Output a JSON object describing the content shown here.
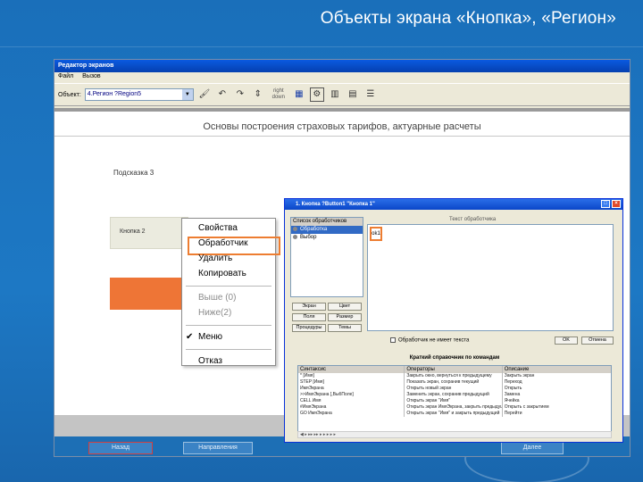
{
  "slide": {
    "title": "Объекты экрана «Кнопка», «Регион»"
  },
  "editor": {
    "title": "Редактор экранов",
    "menu": [
      "Файл",
      "Вызов"
    ],
    "object_label": "Объект:",
    "object_value": "4.Регион ?Region5",
    "toolbar_small_label_1": "right",
    "toolbar_small_label_2": "down",
    "canvas_header": "Основы построения страховых тарифов, актуарные расчеты",
    "hint_label": "Подсказка 3",
    "button2_label": "Кнопка 2",
    "nav_left": "Назад",
    "nav_mid": "Направления",
    "nav_right": "Далее"
  },
  "context_menu": {
    "items": [
      {
        "label": "Свойства",
        "disabled": false
      },
      {
        "label": "Обработчик",
        "disabled": false
      },
      {
        "label": "Удалить",
        "disabled": false
      },
      {
        "label": "Копировать",
        "disabled": false
      },
      {
        "label": "Выше (0)",
        "disabled": true
      },
      {
        "label": "Ниже(2)",
        "disabled": true
      },
      {
        "label": "Меню",
        "disabled": false
      },
      {
        "label": "Отказ",
        "disabled": false
      }
    ]
  },
  "dialog": {
    "title": "1. Кнопка ?Button1 \"Кнопка 1\"",
    "handler_list_header": "Список обработчиков",
    "handlers": [
      "Обработка",
      "Выбор"
    ],
    "code_label": "Текст обработчика",
    "code_tag": "ok1",
    "buttons_left": [
      "Экран",
      "Цвет",
      "Поля",
      "Размер",
      "Процедуры",
      "Темы"
    ],
    "nocode_label": "Обработчик не имеет текста",
    "ok_label": "OK",
    "cancel_label": "Отмена",
    "ref_title": "Краткий справочник по командам",
    "ref_columns": [
      "Синтаксис",
      "Операторы",
      "Описание"
    ],
    "ref_rows": [
      [
        "* [Имя]",
        "Закрыть окно, вернуться к предыдущему",
        "Закрыть экран"
      ],
      [
        "STEP [Имя]",
        "Показать экран, сохранив текущий",
        "Переход"
      ],
      [
        "ИмяЭкрана",
        "Открыть новый экран",
        "Открыть"
      ],
      [
        ">>ИмяЭкрана [,ВыбПоле]",
        "Заменить экран, сохранив предыдущий",
        "Замена"
      ],
      [
        "CELL Имя",
        "Открыть экран \"Имя\"",
        "Ячейка"
      ],
      [
        "#ИмяЭкрана",
        "Открыть экран ИмяЭкрана, закрыть предыдущий",
        "Открыть с закрытием"
      ],
      [
        "GO ИмяЭкрана",
        "Открыть экран \"Имя\" и закрыть предыдущий",
        "Перейти"
      ]
    ]
  }
}
